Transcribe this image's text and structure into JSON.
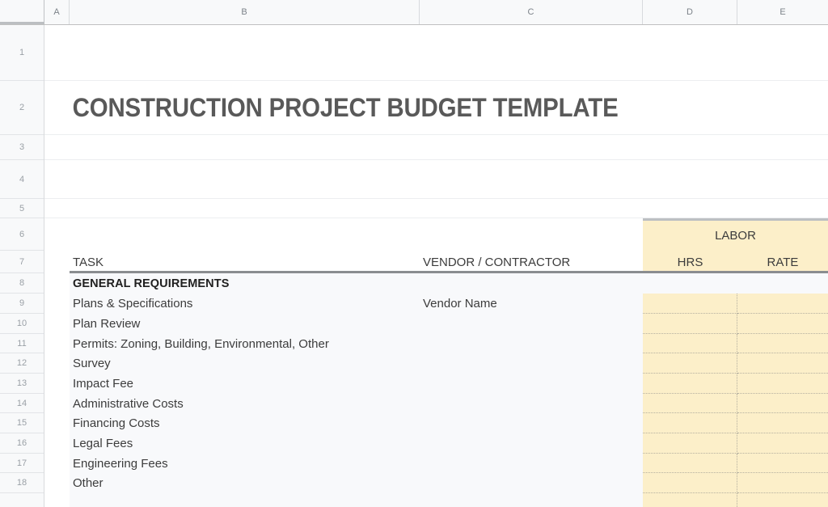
{
  "app": {
    "type": "spreadsheet",
    "colors": {
      "cream_fill": "#FCEFC9",
      "header_rule": "#8A8D90",
      "title_text": "#595959",
      "grid_line": "#E2E4E7",
      "row_header_bg": "#F8F9FA",
      "dotted_border": "#B5B0A0"
    }
  },
  "columns": [
    {
      "id": "A",
      "label": "A"
    },
    {
      "id": "B",
      "label": "B"
    },
    {
      "id": "C",
      "label": "C"
    },
    {
      "id": "D",
      "label": "D"
    },
    {
      "id": "E",
      "label": "E"
    }
  ],
  "rows": [
    {
      "num": "1"
    },
    {
      "num": "2"
    },
    {
      "num": "3"
    },
    {
      "num": "4"
    },
    {
      "num": "5"
    },
    {
      "num": "6"
    },
    {
      "num": "7"
    },
    {
      "num": "8"
    },
    {
      "num": "9"
    },
    {
      "num": "10"
    },
    {
      "num": "11"
    },
    {
      "num": "12"
    },
    {
      "num": "13"
    },
    {
      "num": "14"
    },
    {
      "num": "15"
    },
    {
      "num": "16"
    },
    {
      "num": "17"
    },
    {
      "num": "18"
    }
  ],
  "sheet": {
    "title": "CONSTRUCTION PROJECT BUDGET TEMPLATE",
    "group_header": {
      "labor": "LABOR"
    },
    "headers": {
      "task": "TASK",
      "vendor": "VENDOR / CONTRACTOR",
      "hrs": "HRS",
      "rate": "RATE"
    },
    "section": {
      "name": "GENERAL REQUIREMENTS"
    },
    "tasks": [
      {
        "row": "9",
        "task": "Plans & Specifications",
        "vendor": "Vendor Name"
      },
      {
        "row": "10",
        "task": "Plan Review",
        "vendor": ""
      },
      {
        "row": "11",
        "task": "Permits: Zoning, Building, Environmental, Other",
        "vendor": ""
      },
      {
        "row": "12",
        "task": "Survey",
        "vendor": ""
      },
      {
        "row": "13",
        "task": "Impact Fee",
        "vendor": ""
      },
      {
        "row": "14",
        "task": "Administrative Costs",
        "vendor": ""
      },
      {
        "row": "15",
        "task": "Financing Costs",
        "vendor": ""
      },
      {
        "row": "16",
        "task": "Legal Fees",
        "vendor": ""
      },
      {
        "row": "17",
        "task": "Engineering Fees",
        "vendor": ""
      },
      {
        "row": "18",
        "task": "Other",
        "vendor": ""
      }
    ]
  }
}
